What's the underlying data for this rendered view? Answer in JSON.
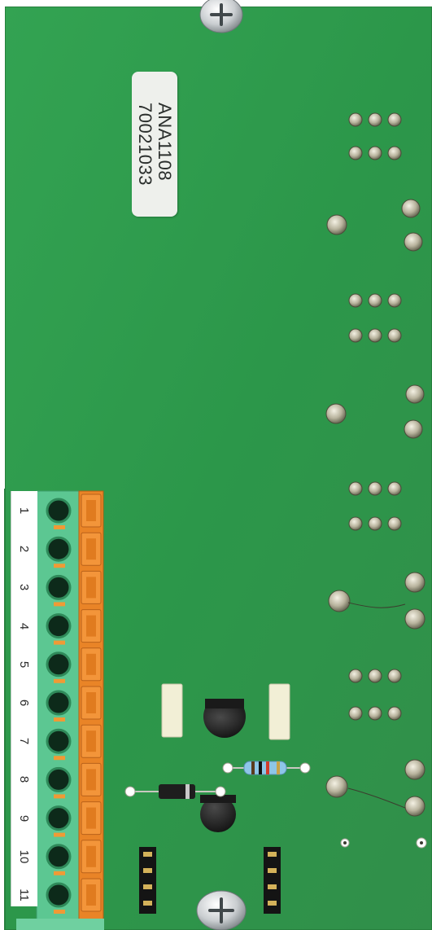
{
  "label": {
    "model": "ANA1108",
    "serial": "70021033"
  },
  "terminal_block": {
    "numbers": [
      "1",
      "2",
      "3",
      "4",
      "5",
      "6",
      "7",
      "8",
      "9",
      "10",
      "11"
    ]
  },
  "colors": {
    "pcb": "#2f9c4e",
    "terminal_body": "#55c48a",
    "lever": "#ef8a2a"
  }
}
